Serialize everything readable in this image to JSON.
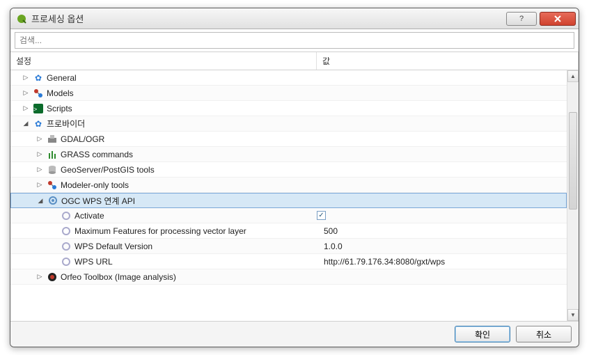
{
  "window": {
    "title": "프로세싱 옵션"
  },
  "search": {
    "placeholder": "검색..."
  },
  "columns": {
    "setting": "설정",
    "value": "값"
  },
  "tree": {
    "general": {
      "label": "General"
    },
    "models": {
      "label": "Models"
    },
    "scripts": {
      "label": "Scripts"
    },
    "providers": {
      "label": "프로바이더",
      "gdal": {
        "label": "GDAL/OGR"
      },
      "grass": {
        "label": "GRASS commands"
      },
      "geoserver": {
        "label": "GeoServer/PostGIS tools"
      },
      "modeler_only": {
        "label": "Modeler-only tools"
      },
      "ogc_wps": {
        "label": "OGC WPS 연계 API",
        "activate": {
          "label": "Activate",
          "checked": true
        },
        "max_features": {
          "label": "Maximum Features for processing vector layer",
          "value": "500"
        },
        "default_version": {
          "label": "WPS Default Version",
          "value": "1.0.0"
        },
        "url": {
          "label": "WPS URL",
          "value": "http://61.79.176.34:8080/gxt/wps"
        }
      },
      "orfeo": {
        "label": "Orfeo Toolbox (Image analysis)"
      }
    }
  },
  "buttons": {
    "ok": "확인",
    "cancel": "취소"
  }
}
